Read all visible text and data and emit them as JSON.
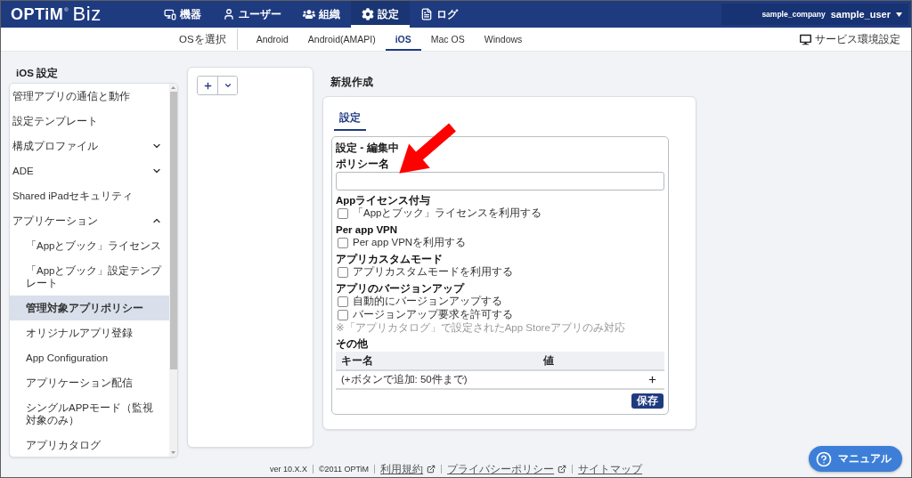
{
  "header": {
    "logo": {
      "brand": "OPTiM",
      "mark": "®",
      "product": "Biz"
    },
    "nav": [
      {
        "label": "機器",
        "kind": "devices",
        "selected": false
      },
      {
        "label": "ユーザー",
        "kind": "user",
        "selected": false
      },
      {
        "label": "組織",
        "kind": "org",
        "selected": false
      },
      {
        "label": "設定",
        "kind": "settings",
        "selected": true
      },
      {
        "label": "ログ",
        "kind": "log",
        "selected": false
      }
    ],
    "account": {
      "company": "sample_company",
      "user": "sample_user"
    }
  },
  "os_bar": {
    "label": "OSを選択",
    "tabs": [
      {
        "label": "Android",
        "selected": false
      },
      {
        "label": "Android(AMAPI)",
        "selected": false
      },
      {
        "label": "iOS",
        "selected": true
      },
      {
        "label": "Mac OS",
        "selected": false
      },
      {
        "label": "Windows",
        "selected": false
      }
    ],
    "service_link": "サービス環境設定"
  },
  "sidebar": {
    "title": "iOS 設定",
    "items": [
      {
        "label": "管理アプリの通信と動作",
        "selected": false
      },
      {
        "label": "設定テンプレート",
        "selected": false
      },
      {
        "label": "構成プロファイル",
        "selected": false,
        "expanded": false
      },
      {
        "label": "ADE",
        "selected": false,
        "expanded": false
      },
      {
        "label": "Shared iPadセキュリティ",
        "selected": false
      },
      {
        "label": "アプリケーション",
        "selected": false,
        "expanded": true,
        "children": [
          {
            "label": "「Appとブック」ライセンス",
            "selected": false
          },
          {
            "label": "「Appとブック」設定テンプレート",
            "selected": false
          },
          {
            "label": "管理対象アプリポリシー",
            "selected": true
          },
          {
            "label": "オリジナルアプリ登録",
            "selected": false
          },
          {
            "label": "App Configuration",
            "selected": false
          },
          {
            "label": "アプリケーション配信",
            "selected": false
          },
          {
            "label": "シングルAPPモード（監視対象のみ）",
            "selected": false
          },
          {
            "label": "アプリカタログ",
            "selected": false
          }
        ]
      }
    ]
  },
  "editor": {
    "title": "新規作成",
    "tabs": [
      {
        "label": "設定",
        "selected": true
      }
    ],
    "form": {
      "title": "設定 - 編集中",
      "fields": [
        {
          "kind": "text",
          "label": "ポリシー名"
        },
        {
          "kind": "checkboxes",
          "label": "Appライセンス付与",
          "options": [
            {
              "label": "「Appとブック」ライセンスを利用する",
              "checked": false
            }
          ]
        },
        {
          "kind": "checkboxes",
          "label": "Per app VPN",
          "options": [
            {
              "label": "Per app VPNを利用する",
              "checked": false
            }
          ]
        },
        {
          "kind": "checkboxes",
          "label": "アプリカスタムモード",
          "options": [
            {
              "label": "アプリカスタムモードを利用する",
              "checked": false
            }
          ]
        },
        {
          "kind": "checkboxes",
          "label": "アプリのバージョンアップ",
          "options": [
            {
              "label": "自動的にバージョンアップする",
              "checked": false
            },
            {
              "label": "バージョンアップ要求を許可する",
              "checked": false
            }
          ],
          "note": "※「アプリカタログ」で設定されたApp Storeアプリのみ対応"
        },
        {
          "kind": "table",
          "label": "その他",
          "columns": [
            "キー名",
            "値"
          ],
          "hint": "(+ボタンで追加: 50件まで)"
        }
      ],
      "save_button": "保存"
    }
  },
  "footer": {
    "version": "ver 10.X.X",
    "copyright": "©2011 OPTiM",
    "links": [
      {
        "label": "利用規約",
        "external": true
      },
      {
        "label": "プライバシーポリシー",
        "external": true
      },
      {
        "label": "サイトマップ",
        "external": false
      }
    ]
  },
  "help_button": {
    "label": "マニュアル"
  }
}
